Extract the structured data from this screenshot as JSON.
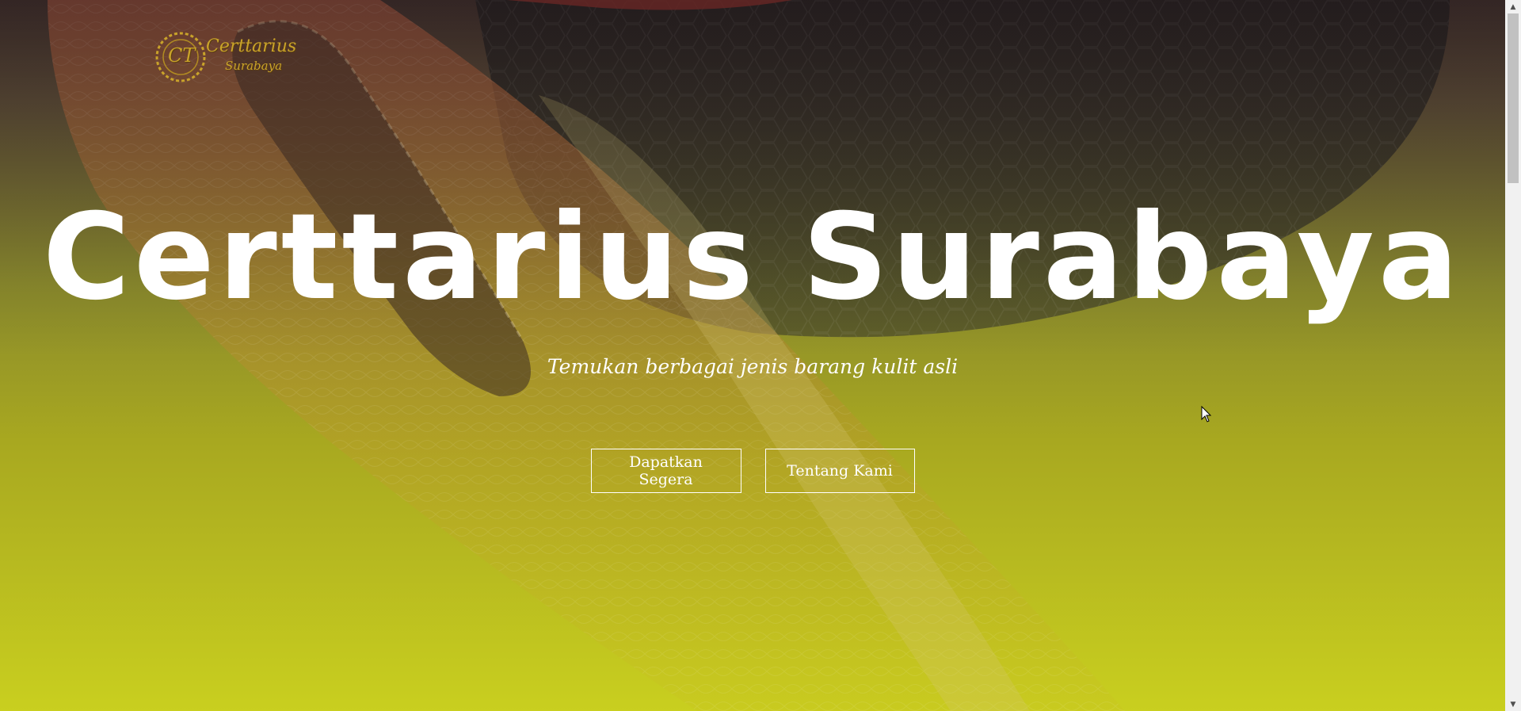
{
  "brand": {
    "logo_monogram": "CT",
    "logo_name": "Certtarius",
    "logo_city": "Surabaya"
  },
  "hero": {
    "title": "Certtarius Surabaya",
    "subtitle": "Temukan berbagai jenis barang kulit asli",
    "primary_button": "Dapatkan Segera",
    "secondary_button": "Tentang Kami"
  },
  "scrollbar": {
    "up_icon": "triangle-up",
    "down_icon": "triangle-down"
  },
  "colors": {
    "hero_text": "#ffffff",
    "gradient_top": "#3a2a28",
    "gradient_bottom": "#c9cf1f",
    "logo_gold": "#c9a32a"
  }
}
